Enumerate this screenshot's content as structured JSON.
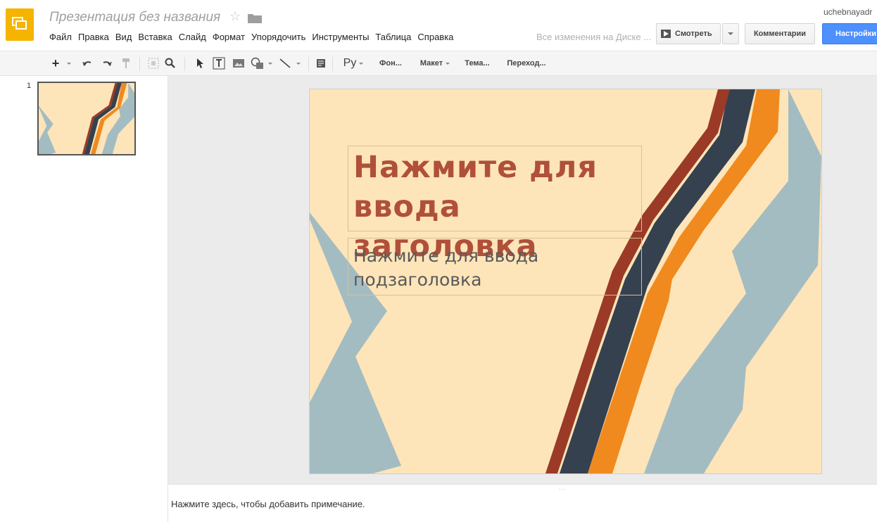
{
  "header": {
    "doc_title": "Презентация без названия",
    "user_email": "uchebnayadr",
    "save_status": "Все изменения на Диске ...",
    "present_label": "Смотреть",
    "comments_label": "Комментарии",
    "share_label": "Настройки доступа",
    "star_icon": "star-icon",
    "folder_icon": "folder-icon"
  },
  "menu": [
    "Файл",
    "Правка",
    "Вид",
    "Вставка",
    "Слайд",
    "Формат",
    "Упорядочить",
    "Инструменты",
    "Таблица",
    "Справка"
  ],
  "toolbar": {
    "input_tools_label": "Ру",
    "background_label": "Фон...",
    "layout_label": "Макет",
    "theme_label": "Тема...",
    "transition_label": "Переход..."
  },
  "filmstrip": {
    "slides": [
      {
        "number": "1"
      }
    ]
  },
  "slide": {
    "title_placeholder": "Нажмите для ввода заголовка",
    "subtitle_placeholder": "Нажмите для ввода подзаголовка"
  },
  "notes": {
    "grip": "...",
    "placeholder": "Нажмите здесь, чтобы добавить примечание."
  },
  "colors": {
    "brand": "#f4b400",
    "slide_background": "#fde5b9",
    "title": "#b0503a",
    "stripe_rust": "#9b3a26",
    "stripe_navy": "#36414f",
    "stripe_orange": "#f08a1f",
    "stripe_bluegray": "#a3bcc1",
    "share_button": "#4d90fe"
  }
}
